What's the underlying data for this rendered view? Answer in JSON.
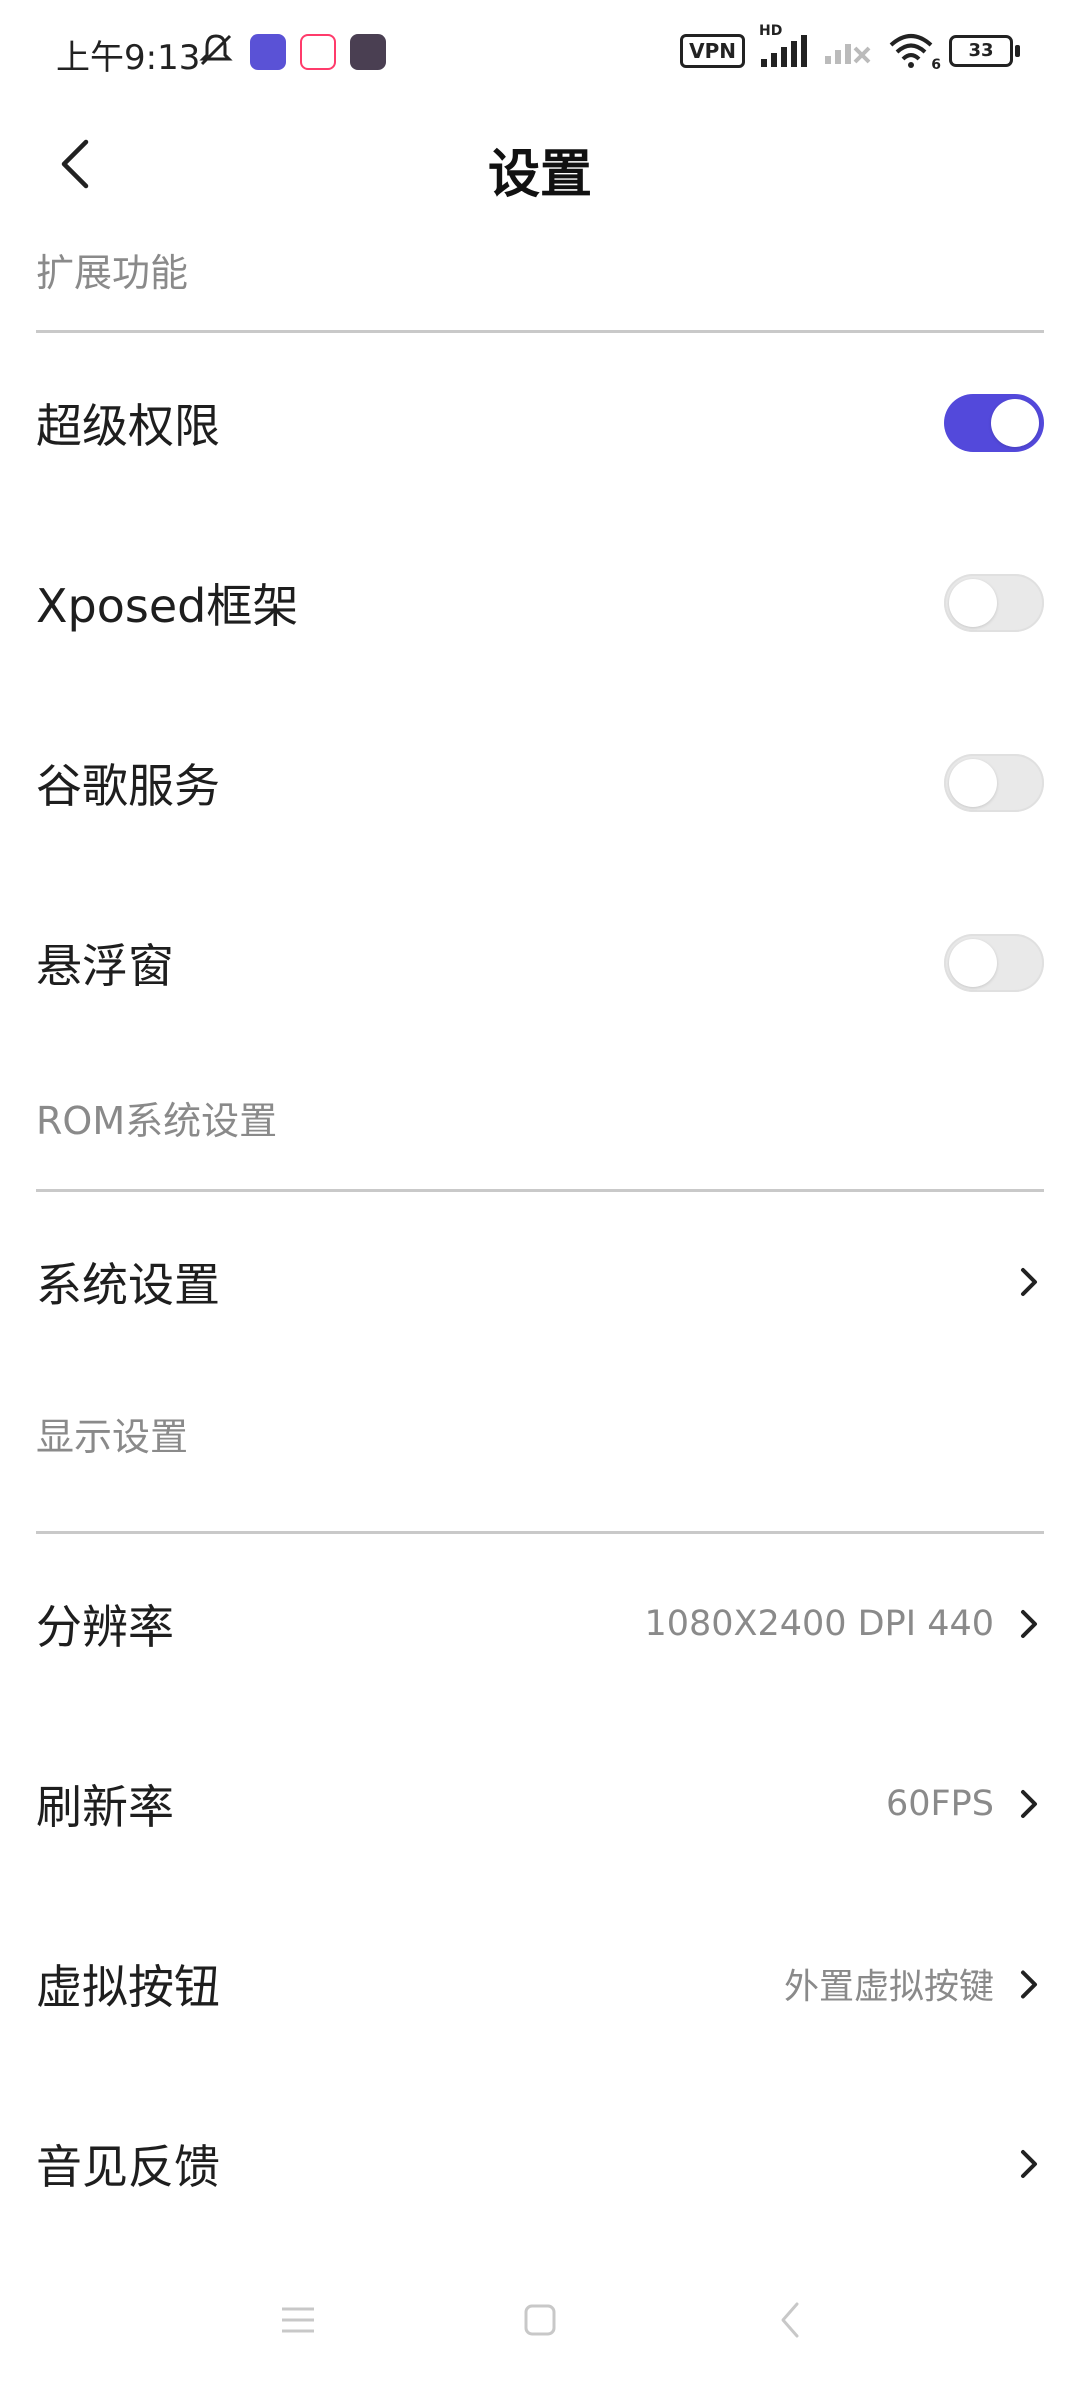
{
  "status_bar": {
    "time": "上午9:13",
    "vpn_label": "VPN",
    "network_label": "HD",
    "wifi_label": "6",
    "battery_level": "33"
  },
  "header": {
    "title": "设置"
  },
  "sections": {
    "extended": {
      "title": "扩展功能",
      "items": [
        {
          "label": "超级权限",
          "enabled": true
        },
        {
          "label": "Xposed框架",
          "enabled": false
        },
        {
          "label": "谷歌服务",
          "enabled": false
        },
        {
          "label": "悬浮窗",
          "enabled": false
        }
      ]
    },
    "rom": {
      "title": "ROM系统设置",
      "items": [
        {
          "label": "系统设置"
        }
      ]
    },
    "display": {
      "title": "显示设置",
      "items": [
        {
          "label": "分辨率",
          "value": "1080X2400 DPI 440"
        },
        {
          "label": "刷新率",
          "value": "60FPS"
        },
        {
          "label": "虚拟按钮",
          "value": "外置虚拟按键"
        },
        {
          "label": "音见反馈"
        }
      ]
    }
  },
  "colors": {
    "accent": "#5349db",
    "toggle_off": "#e9e9e9",
    "secondary_text": "#8a8a8a"
  }
}
